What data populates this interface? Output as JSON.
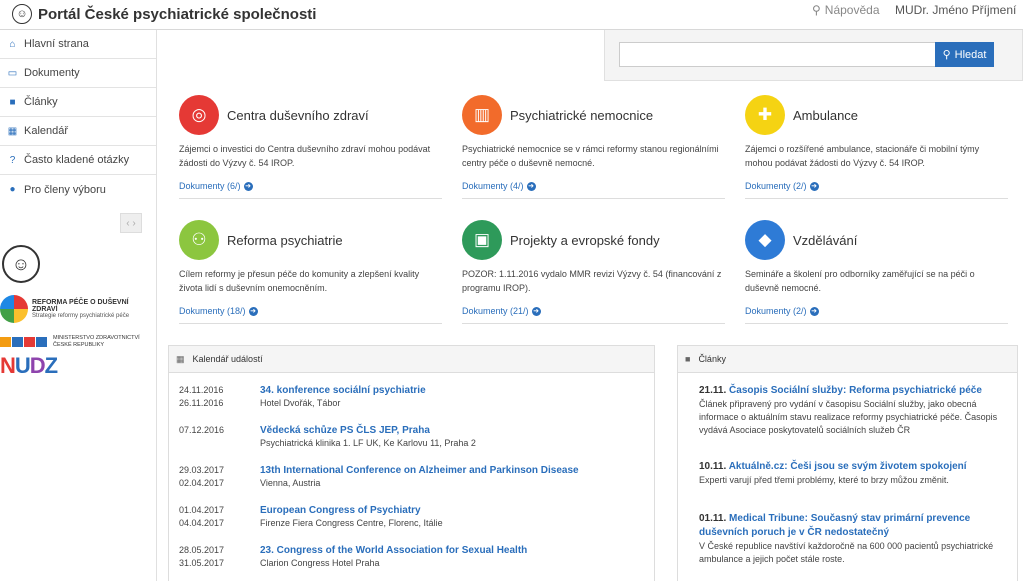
{
  "header": {
    "title": "Portál České psychiatrické společnosti",
    "help_label": "Nápověda",
    "user_label": "MUDr. Jméno Příjmení"
  },
  "sidebar": {
    "items": [
      {
        "label": "Hlavní strana",
        "icon": "home-icon"
      },
      {
        "label": "Dokumenty",
        "icon": "document-icon"
      },
      {
        "label": "Články",
        "icon": "book-icon"
      },
      {
        "label": "Kalendář",
        "icon": "calendar-icon"
      },
      {
        "label": "Často kladené otázky",
        "icon": "question-icon"
      },
      {
        "label": "Pro členy výboru",
        "icon": "users-icon"
      }
    ],
    "logos": {
      "reforma_line1": "REFORMA PÉČE O DUŠEVNÍ ZDRAVÍ",
      "reforma_line2": "Strategie reformy psychiatrické péče",
      "mzcr_line1": "MINISTERSTVO ZDRAVOTNICTVÍ",
      "mzcr_line2": "ČESKÉ REPUBLIKY",
      "nudz": "NUDZ"
    }
  },
  "search": {
    "placeholder": "",
    "button_label": "Hledat"
  },
  "cards": [
    {
      "title": "Centra duševního zdraví",
      "color": "#e53935",
      "icon": "target-icon",
      "desc": "Zájemci o investici do Centra duševního zdraví mohou podávat žádosti do Výzvy č. 54 IROP.",
      "link": "Dokumenty (6/)"
    },
    {
      "title": "Psychiatrické nemocnice",
      "color": "#f26b2b",
      "icon": "building-icon",
      "desc": "Psychiatrické nemocnice se v rámci reformy stanou regionálními centry péče o duševně nemocné.",
      "link": "Dokumenty (4/)"
    },
    {
      "title": "Ambulance",
      "color": "#f5d313",
      "icon": "doctor-icon",
      "desc": "Zájemci o rozšířené ambulance, stacionáře či mobilní týmy mohou podávat žádosti do Výzvy č. 54 IROP.",
      "link": "Dokumenty (2/)"
    },
    {
      "title": "Reforma psychiatrie",
      "color": "#8cc63f",
      "icon": "hierarchy-icon",
      "desc": "Cílem reformy je přesun péče do komunity a zlepšení kvality života lidí s duševním onemocněním.",
      "link": "Dokumenty (18/)"
    },
    {
      "title": "Projekty a evropské fondy",
      "color": "#2e9a5a",
      "icon": "money-icon",
      "desc": "POZOR: 1.11.2016 vydalo MMR revizi Výzvy č. 54 (financování z programu IROP).",
      "link": "Dokumenty (21/)"
    },
    {
      "title": "Vzdělávání",
      "color": "#2e7bd6",
      "icon": "graduation-cap-icon",
      "desc": "Semináře a školení pro odborníky zaměřující se na péči o duševně nemocné.",
      "link": "Dokumenty (2/)"
    }
  ],
  "calendar": {
    "title": "Kalendář událostí",
    "events": [
      {
        "date1": "24.11.2016",
        "date2": "26.11.2016",
        "title": "34. konference sociální psychiatrie",
        "place": "Hotel Dvořák, Tábor"
      },
      {
        "date1": "07.12.2016",
        "date2": "",
        "title": "Vědecká schůze PS ČLS JEP, Praha",
        "place": "Psychiatrická klinika 1. LF UK, Ke Karlovu 11, Praha 2"
      },
      {
        "date1": "29.03.2017",
        "date2": "02.04.2017",
        "title": "13th International Conference on Alzheimer and Parkinson Disease",
        "place": "Vienna, Austria"
      },
      {
        "date1": "01.04.2017",
        "date2": "04.04.2017",
        "title": "European Congress of Psychiatry",
        "place": "Firenze Fiera Congress Centre, Florenc, Itálie"
      },
      {
        "date1": "28.05.2017",
        "date2": "31.05.2017",
        "title": "23. Congress of the World Association for Sexual Health",
        "place": "Clarion Congress Hotel Praha"
      }
    ]
  },
  "articles": {
    "title": "Články",
    "items": [
      {
        "date": "21.11.",
        "title": "Časopis Sociální služby: Reforma psychiatrické péče",
        "text": "Článek připravený pro vydání v časopisu Sociální služby, jako obecná informace o aktuálním stavu realizace reformy psychiatrické péče. Časopis vydává Asociace poskytovatelů sociálních služeb ČR"
      },
      {
        "date": "10.11.",
        "title": "Aktuálně.cz: Češi jsou se svým životem spokojení",
        "text": "Experti varují před třemi problémy, které to brzy můžou změnit."
      },
      {
        "date": "01.11.",
        "title": "Medical Tribune: Současný stav primární prevence duševních poruch je v ČR nedostatečný",
        "text": "V České republice navštíví každoročně na 600 000 pacientů psychiatrické ambulance a jejich počet stále roste."
      }
    ]
  }
}
